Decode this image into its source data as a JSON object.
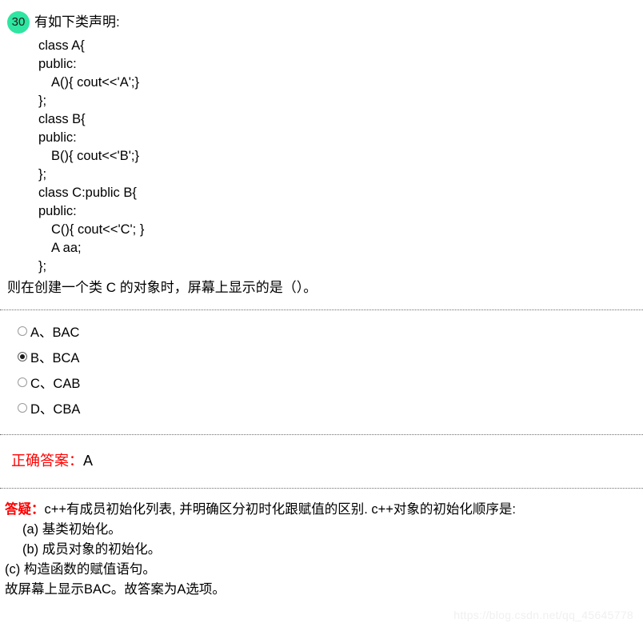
{
  "question": {
    "number": "30",
    "title": "有如下类声明:",
    "code_lines": [
      {
        "text": "class A{",
        "indent": 0
      },
      {
        "text": "public:",
        "indent": 0
      },
      {
        "text": "A(){ cout<<'A';}",
        "indent": 1
      },
      {
        "text": "};",
        "indent": 0
      },
      {
        "text": "class B{",
        "indent": 0
      },
      {
        "text": "public:",
        "indent": 0
      },
      {
        "text": "B(){ cout<<'B';}",
        "indent": 1
      },
      {
        "text": "};",
        "indent": 0
      },
      {
        "text": "class C:public B{",
        "indent": 0
      },
      {
        "text": "public:",
        "indent": 0
      },
      {
        "text": "C(){ cout<<'C'; }",
        "indent": 1
      },
      {
        "text": "A aa;",
        "indent": 1
      },
      {
        "text": "};",
        "indent": 0
      }
    ],
    "statement": "则在创建一个类 C 的对象时，屏幕上显示的是（）。"
  },
  "options": [
    {
      "label": "A、BAC",
      "selected": false
    },
    {
      "label": "B、BCA",
      "selected": true
    },
    {
      "label": "C、CAB",
      "selected": false
    },
    {
      "label": "D、CBA",
      "selected": false
    }
  ],
  "answer": {
    "label": "正确答案：",
    "value": "A"
  },
  "explanation": {
    "label": "答疑：",
    "lead": "c++有成员初始化列表, 并明确区分初时化跟赋值的区别. c++对象的初始化顺序是:",
    "lines": [
      {
        "text": "(a) 基类初始化。",
        "indent": true
      },
      {
        "text": "(b) 成员对象的初始化。",
        "indent": true
      },
      {
        "text": "(c) 构造函数的赋值语句。",
        "indent": false
      },
      {
        "text": "故屏幕上显示BAC。故答案为A选项。",
        "indent": false
      }
    ]
  },
  "watermark": "https://blog.csdn.net/qq_45645778",
  "colors": {
    "badge": "#2fe5a1",
    "accent_red": "#ff0000",
    "separator": "#6e6e6e",
    "watermark": "#f0f0f0"
  }
}
